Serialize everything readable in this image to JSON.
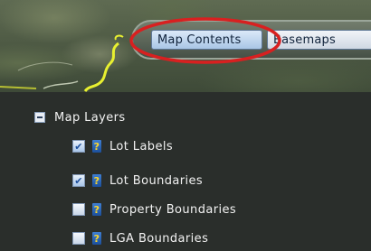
{
  "tabs": {
    "map_contents": "Map Contents",
    "basemaps": "Basemaps"
  },
  "layers": {
    "group_label": "Map Layers",
    "items": [
      {
        "label": "Lot Labels",
        "checked": true
      },
      {
        "label": "Lot Boundaries",
        "checked": true
      },
      {
        "label": "Property Boundaries",
        "checked": false
      },
      {
        "label": "LGA Boundaries",
        "checked": false
      }
    ]
  },
  "icons": {
    "expander": "collapse-minus-icon",
    "help": "help-question-icon",
    "check": "checkmark-icon"
  },
  "colors": {
    "panel_bg": "#2a2e2b",
    "active_tab": "#a9c6e6",
    "highlight": "#d82020",
    "boundary": "#e8f030",
    "help_bg": "#1c4f9a",
    "help_fg": "#ffd82a"
  }
}
